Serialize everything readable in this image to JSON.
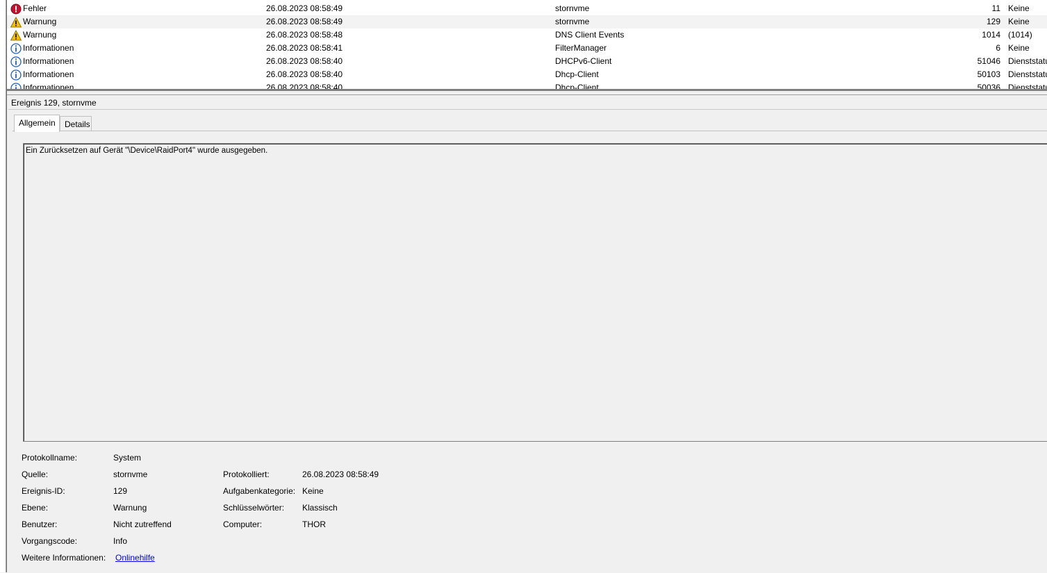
{
  "colors": {
    "error": "#c8102e",
    "warning": "#f2c000",
    "info": "#1e5fbf",
    "link": "#0000ee"
  },
  "events": [
    {
      "level": "Fehler",
      "icon": "error-icon",
      "date": "26.08.2023 08:58:49",
      "source": "stornvme",
      "id": "11",
      "task": "Keine"
    },
    {
      "level": "Warnung",
      "icon": "warning-icon",
      "date": "26.08.2023 08:58:49",
      "source": "stornvme",
      "id": "129",
      "task": "Keine"
    },
    {
      "level": "Warnung",
      "icon": "warning-icon",
      "date": "26.08.2023 08:58:48",
      "source": "DNS Client Events",
      "id": "1014",
      "task": "(1014)"
    },
    {
      "level": "Informationen",
      "icon": "info-icon",
      "date": "26.08.2023 08:58:41",
      "source": "FilterManager",
      "id": "6",
      "task": "Keine"
    },
    {
      "level": "Informationen",
      "icon": "info-icon",
      "date": "26.08.2023 08:58:40",
      "source": "DHCPv6-Client",
      "id": "51046",
      "task": "Dienststatu"
    },
    {
      "level": "Informationen",
      "icon": "info-icon",
      "date": "26.08.2023 08:58:40",
      "source": "Dhcp-Client",
      "id": "50103",
      "task": "Dienststatu"
    },
    {
      "level": "Informationen",
      "icon": "info-icon",
      "date": "26.08.2023 08:58:40",
      "source": "Dhcp-Client",
      "id": "50036",
      "task": "Dienststatu"
    }
  ],
  "detail": {
    "header": "Ereignis 129, stornvme",
    "tabs": [
      "Allgemein",
      "Details"
    ],
    "message": "Ein Zurücksetzen auf Gerät \"\\Device\\RaidPort4\" wurde ausgegeben.",
    "labels": {
      "protokollname": "Protokollname:",
      "quelle": "Quelle:",
      "ereignis_id": "Ereignis-ID:",
      "ebene": "Ebene:",
      "benutzer": "Benutzer:",
      "vorgangscode": "Vorgangscode:",
      "weitere": "Weitere Informationen:",
      "protokolliert": "Protokolliert:",
      "aufgabenkategorie": "Aufgabenkategorie:",
      "schluesselwoerter": "Schlüsselwörter:",
      "computer": "Computer:"
    },
    "values": {
      "protokollname": "System",
      "quelle": "stornvme",
      "ereignis_id": "129",
      "ebene": "Warnung",
      "benutzer": "Nicht zutreffend",
      "vorgangscode": "Info",
      "weitere": "Onlinehilfe",
      "protokolliert": "26.08.2023 08:58:49",
      "aufgabenkategorie": "Keine",
      "schluesselwoerter": "Klassisch",
      "computer": "THOR"
    }
  }
}
